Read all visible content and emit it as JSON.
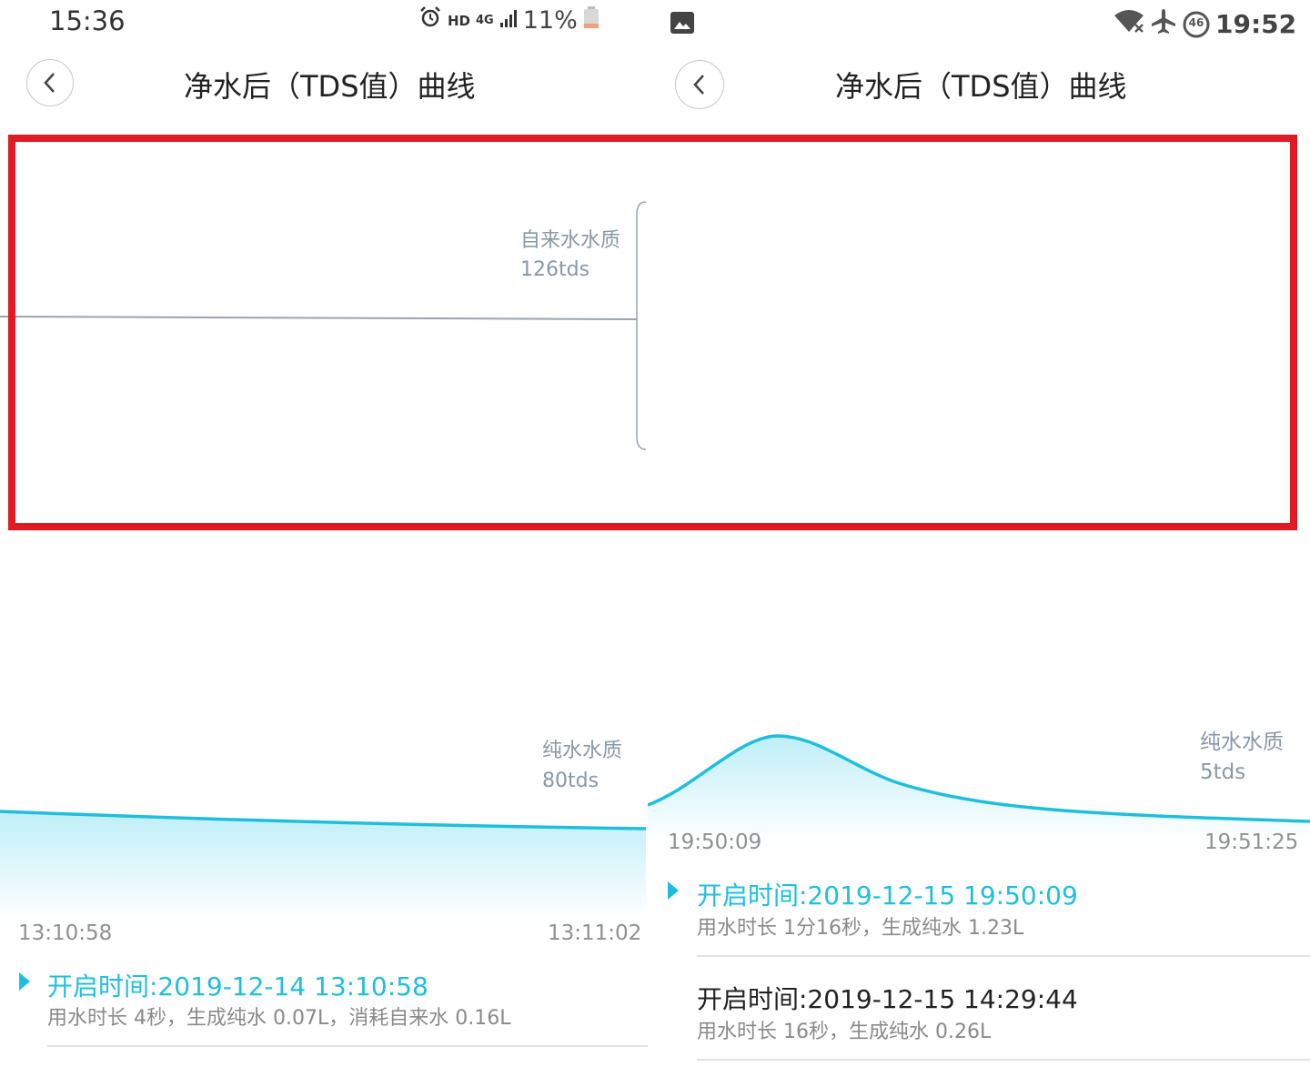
{
  "left_screen": {
    "status_time": "15:36",
    "status_hd": "HD",
    "status_network": "4G",
    "status_battery": "11%",
    "title": "净水后（TDS值）曲线",
    "tap_water_label": "自来水水质",
    "tap_water_value": "126tds",
    "pure_water_label": "纯水水质",
    "pure_water_value": "80tds",
    "time_start": "13:10:58",
    "time_end": "13:11:02",
    "entries": [
      {
        "title": "开启时间:2019-12-14 13:10:58",
        "subtitle": "用水时长 4秒，生成纯水 0.07L，消耗自来水 0.16L",
        "active": true
      }
    ]
  },
  "right_screen": {
    "status_time": "19:52",
    "status_badge": "46",
    "title": "净水后（TDS值）曲线",
    "pure_water_label": "纯水水质",
    "pure_water_value": "5tds",
    "time_start": "19:50:09",
    "time_end": "19:51:25",
    "entries": [
      {
        "title": "开启时间:2019-12-15 19:50:09",
        "subtitle": "用水时长 1分16秒，生成纯水 1.23L",
        "active": true
      },
      {
        "title": "开启时间:2019-12-15 14:29:44",
        "subtitle": "用水时长 16秒，生成纯水 0.26L",
        "active": false
      }
    ]
  },
  "colors": {
    "accent": "#1fbfdc",
    "highlight_box": "#e01b24",
    "label_grey": "#8a98a6"
  }
}
